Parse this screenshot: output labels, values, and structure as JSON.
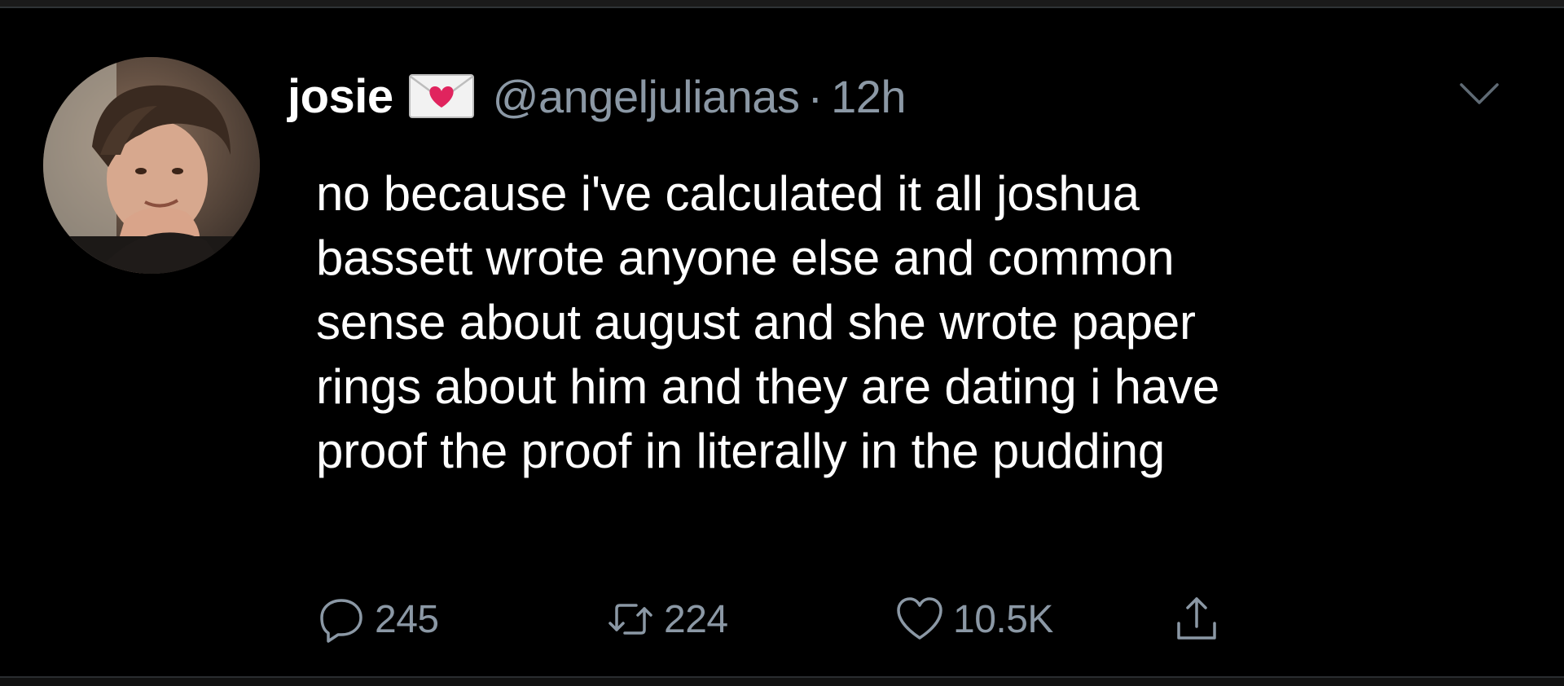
{
  "tweet": {
    "author": {
      "display_name": "josie",
      "name_emoji": "love-letter-icon",
      "handle": "@angeljulianas",
      "separator": "·",
      "timestamp": "12h"
    },
    "text_lines": [
      "no because i've calculated it all joshua",
      "bassett wrote anyone else and common",
      "sense about august and she wrote paper",
      "rings about him and they are dating i have",
      "proof the proof in literally in the pudding"
    ],
    "actions": {
      "reply": {
        "icon": "reply-icon",
        "count": "245"
      },
      "retweet": {
        "icon": "retweet-icon",
        "count": "224"
      },
      "like": {
        "icon": "heart-icon",
        "count": "10.5K"
      },
      "share": {
        "icon": "share-icon"
      }
    },
    "menu_icon": "chevron-down-icon"
  },
  "colors": {
    "background": "#000000",
    "primary_text": "#ffffff",
    "secondary_text": "#8b98a5",
    "envelope_heart": "#e0245e"
  }
}
